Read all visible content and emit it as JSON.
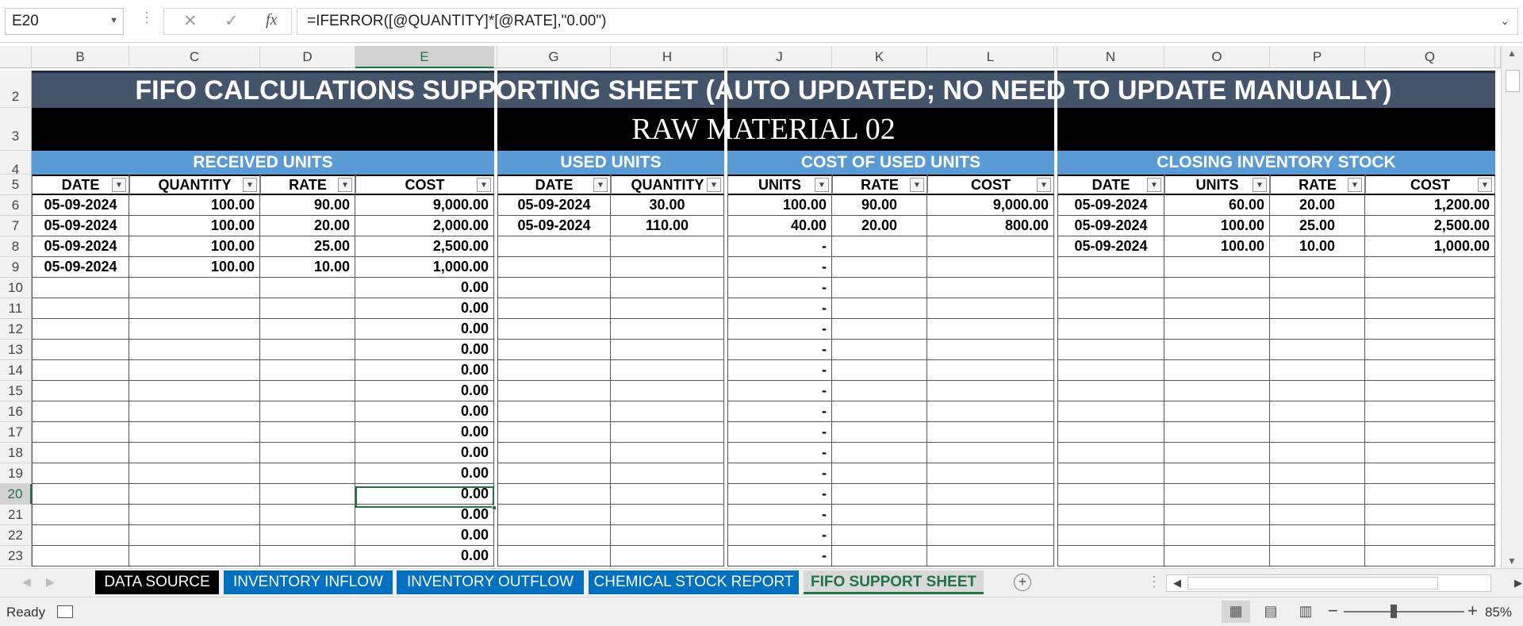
{
  "formula_bar": {
    "name_box": "E20",
    "formula": "=IFERROR([@QUANTITY]*[@RATE],\"0.00\")"
  },
  "columns": [
    "B",
    "C",
    "D",
    "E",
    "G",
    "H",
    "J",
    "K",
    "L",
    "N",
    "O",
    "P",
    "Q"
  ],
  "selected_column": "E",
  "rows": [
    "2",
    "3",
    "4",
    "5",
    "6",
    "7",
    "8",
    "9",
    "10",
    "11",
    "12",
    "13",
    "14",
    "15",
    "16",
    "17",
    "18",
    "19",
    "20",
    "21",
    "22",
    "23"
  ],
  "selected_row": "20",
  "sheet": {
    "title": "FIFO CALCULATIONS SUPPORTING SHEET (AUTO UPDATED; NO NEED TO UPDATE MANUALLY)",
    "subtitle": "RAW MATERIAL 02",
    "sections": [
      "RECEIVED UNITS",
      "USED UNITS",
      "COST OF USED UNITS",
      "CLOSING INVENTORY STOCK"
    ],
    "headers": [
      "DATE",
      "QUANTITY",
      "RATE",
      "COST",
      "DATE",
      "QUANTITY",
      "UNITS",
      "RATE",
      "COST",
      "DATE",
      "UNITS",
      "RATE",
      "COST"
    ],
    "data_rows": [
      [
        "05-09-2024",
        "100.00",
        "90.00",
        "9,000.00",
        "05-09-2024",
        "30.00",
        "100.00",
        "90.00",
        "9,000.00",
        "05-09-2024",
        "60.00",
        "20.00",
        "1,200.00"
      ],
      [
        "05-09-2024",
        "100.00",
        "20.00",
        "2,000.00",
        "05-09-2024",
        "110.00",
        "40.00",
        "20.00",
        "800.00",
        "05-09-2024",
        "100.00",
        "25.00",
        "2,500.00"
      ],
      [
        "05-09-2024",
        "100.00",
        "25.00",
        "2,500.00",
        "",
        "",
        "-",
        "",
        "",
        "05-09-2024",
        "100.00",
        "10.00",
        "1,000.00"
      ],
      [
        "05-09-2024",
        "100.00",
        "10.00",
        "1,000.00",
        "",
        "",
        "-",
        "",
        "",
        "",
        "",
        "",
        ""
      ],
      [
        "",
        "",
        "",
        "0.00",
        "",
        "",
        "-",
        "",
        "",
        "",
        "",
        "",
        ""
      ],
      [
        "",
        "",
        "",
        "0.00",
        "",
        "",
        "-",
        "",
        "",
        "",
        "",
        "",
        ""
      ],
      [
        "",
        "",
        "",
        "0.00",
        "",
        "",
        "-",
        "",
        "",
        "",
        "",
        "",
        ""
      ],
      [
        "",
        "",
        "",
        "0.00",
        "",
        "",
        "-",
        "",
        "",
        "",
        "",
        "",
        ""
      ],
      [
        "",
        "",
        "",
        "0.00",
        "",
        "",
        "-",
        "",
        "",
        "",
        "",
        "",
        ""
      ],
      [
        "",
        "",
        "",
        "0.00",
        "",
        "",
        "-",
        "",
        "",
        "",
        "",
        "",
        ""
      ],
      [
        "",
        "",
        "",
        "0.00",
        "",
        "",
        "-",
        "",
        "",
        "",
        "",
        "",
        ""
      ],
      [
        "",
        "",
        "",
        "0.00",
        "",
        "",
        "-",
        "",
        "",
        "",
        "",
        "",
        ""
      ],
      [
        "",
        "",
        "",
        "0.00",
        "",
        "",
        "-",
        "",
        "",
        "",
        "",
        "",
        ""
      ],
      [
        "",
        "",
        "",
        "0.00",
        "",
        "",
        "-",
        "",
        "",
        "",
        "",
        "",
        ""
      ],
      [
        "",
        "",
        "",
        "0.00",
        "",
        "",
        "-",
        "",
        "",
        "",
        "",
        "",
        ""
      ],
      [
        "",
        "",
        "",
        "0.00",
        "",
        "",
        "-",
        "",
        "",
        "",
        "",
        "",
        ""
      ],
      [
        "",
        "",
        "",
        "0.00",
        "",
        "",
        "-",
        "",
        "",
        "",
        "",
        "",
        ""
      ],
      [
        "",
        "",
        "",
        "0.00",
        "",
        "",
        "-",
        "",
        "",
        "",
        "",
        "",
        ""
      ]
    ]
  },
  "tabs": [
    {
      "label": "DATA SOURCE",
      "style": "black"
    },
    {
      "label": "INVENTORY INFLOW",
      "style": "blue"
    },
    {
      "label": "INVENTORY OUTFLOW",
      "style": "blue"
    },
    {
      "label": "CHEMICAL STOCK REPORT",
      "style": "blue"
    },
    {
      "label": "FIFO SUPPORT SHEET",
      "style": "active"
    }
  ],
  "status": {
    "ready": "Ready",
    "zoom": "85%",
    "zoom_level_percent": 85
  },
  "icons": {
    "cancel": "close-icon",
    "enter": "check-icon",
    "function": "fx-icon",
    "filter": "chevron-down-icon",
    "add_sheet": "plus-icon"
  },
  "colors": {
    "title_bg": "#44546a",
    "subtitle_bg": "#000000",
    "section_bg": "#5b9bd5",
    "tab_blue": "#0070c0",
    "excel_green": "#217346"
  }
}
